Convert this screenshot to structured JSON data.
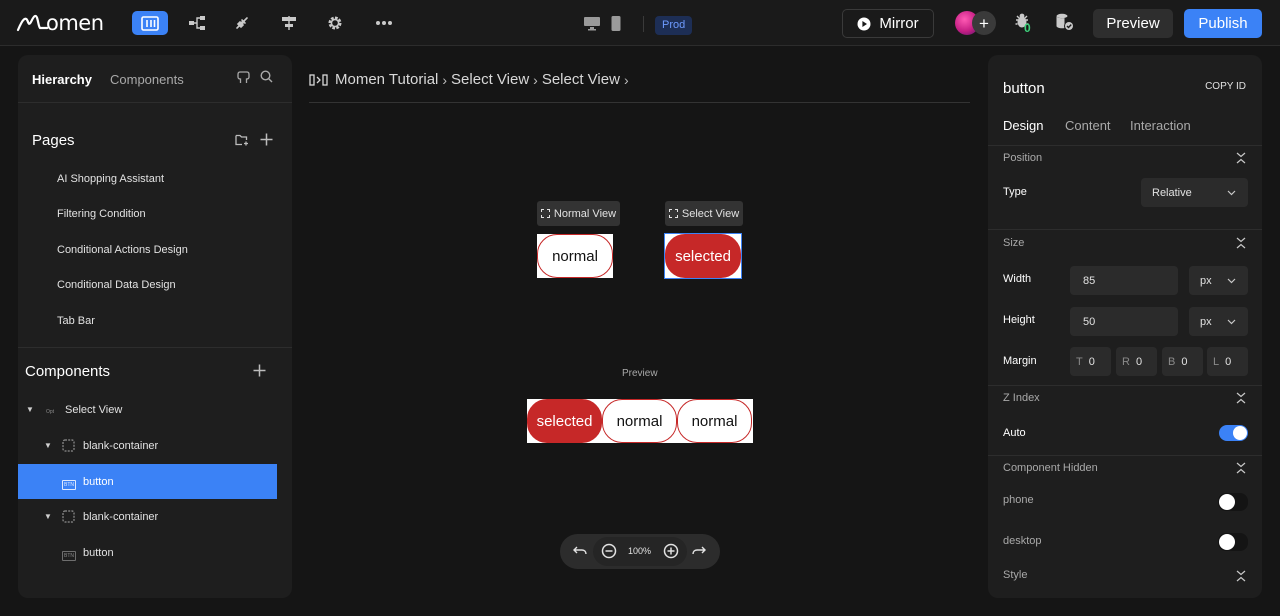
{
  "topbar": {
    "logo_text": "omen",
    "prod_badge": "Prod",
    "mirror_label": "Mirror",
    "bug_count": "0",
    "preview_label": "Preview",
    "publish_label": "Publish"
  },
  "left_panel": {
    "tabs": [
      "Hierarchy",
      "Components"
    ],
    "pages_title": "Pages",
    "pages": [
      "AI Shopping Assistant",
      "Filtering Condition",
      "Conditional Actions Design",
      "Conditional Data Design",
      "Tab Bar"
    ],
    "components_title": "Components",
    "tree": [
      {
        "label": "Select View",
        "tag": "Opt"
      },
      {
        "label": "blank-container"
      },
      {
        "label": "button",
        "tag": "BTN",
        "selected": true
      },
      {
        "label": "blank-container"
      },
      {
        "label": "button",
        "tag": "BTN"
      }
    ]
  },
  "canvas": {
    "breadcrumb": [
      "Momen Tutorial",
      "Select View",
      "Select View"
    ],
    "normal_view_label": "Normal View",
    "select_view_label": "Select View",
    "normal_button": "normal",
    "selected_button": "selected",
    "preview_label": "Preview",
    "preview_buttons": [
      "selected",
      "normal",
      "normal"
    ],
    "zoom": "100%"
  },
  "right_panel": {
    "title": "button",
    "copy_id": "COPY ID",
    "tabs": [
      "Design",
      "Content",
      "Interaction"
    ],
    "position_section": "Position",
    "type_label": "Type",
    "type_value": "Relative",
    "size_section": "Size",
    "width_label": "Width",
    "width_value": "85",
    "width_unit": "px",
    "height_label": "Height",
    "height_value": "50",
    "height_unit": "px",
    "margin_label": "Margin",
    "margins": [
      {
        "k": "T",
        "v": "0"
      },
      {
        "k": "R",
        "v": "0"
      },
      {
        "k": "B",
        "v": "0"
      },
      {
        "k": "L",
        "v": "0"
      }
    ],
    "zindex_section": "Z Index",
    "auto_label": "Auto",
    "auto_on": true,
    "hidden_section": "Component Hidden",
    "phone_label": "phone",
    "desktop_label": "desktop",
    "style_section": "Style"
  },
  "colors": {
    "accent": "#3b82f6",
    "button_red": "#c62828",
    "bug_count_green": "#3ed27b"
  }
}
